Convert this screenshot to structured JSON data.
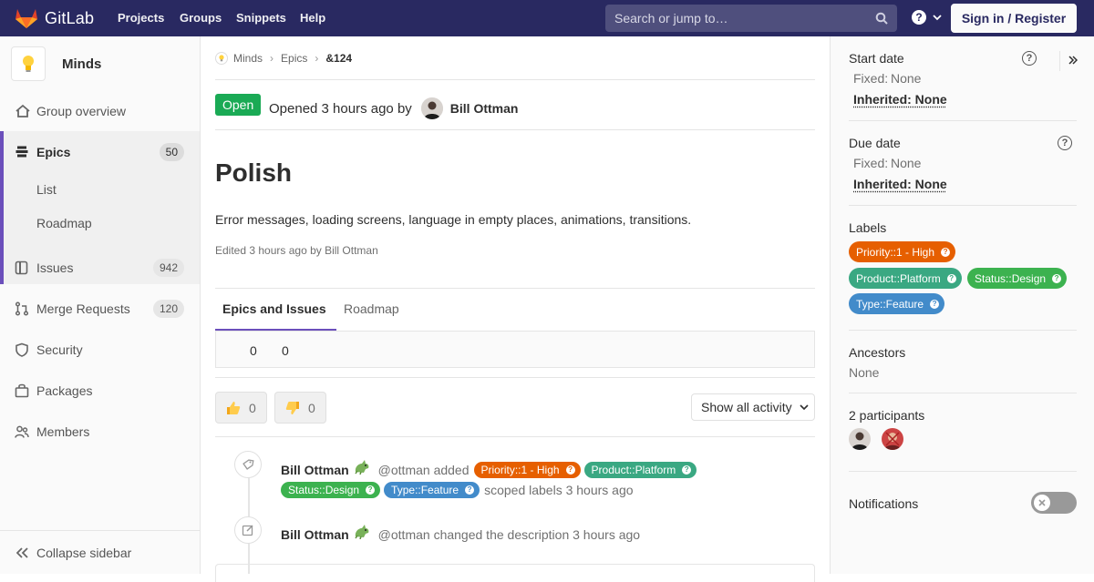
{
  "topnav": {
    "brand": "GitLab",
    "links": [
      "Projects",
      "Groups",
      "Snippets",
      "Help"
    ],
    "search_placeholder": "Search or jump to…",
    "signin_label": "Sign in / Register"
  },
  "sidebar": {
    "group_name": "Minds",
    "items": [
      {
        "label": "Group overview"
      },
      {
        "label": "Epics",
        "count": "50"
      },
      {
        "label": "List"
      },
      {
        "label": "Roadmap"
      },
      {
        "label": "Issues",
        "count": "942"
      },
      {
        "label": "Merge Requests",
        "count": "120"
      },
      {
        "label": "Security"
      },
      {
        "label": "Packages"
      },
      {
        "label": "Members"
      }
    ],
    "collapse_label": "Collapse sidebar"
  },
  "breadcrumb": [
    "Minds",
    "Epics",
    "&124"
  ],
  "epic": {
    "status": "Open",
    "opened_text": "Opened 3 hours ago by",
    "author": "Bill Ottman",
    "title": "Polish",
    "description": "Error messages, loading screens, language in empty places, animations, transitions.",
    "edited": "Edited 3 hours ago by Bill Ottman"
  },
  "tabs": [
    "Epics and Issues",
    "Roadmap"
  ],
  "counts": [
    "0",
    "0"
  ],
  "awards": {
    "thumbsup": "0",
    "thumbsdown": "0"
  },
  "activity_filter": "Show all activity",
  "notes": [
    {
      "author": "Bill Ottman",
      "handle": "@ottman added",
      "labels_line1": [
        {
          "text": "Priority::1 - High",
          "color": "#e65f00"
        },
        {
          "text": "Product::Platform",
          "color": "#3aa882"
        }
      ],
      "labels_line2": [
        {
          "text": "Status::Design",
          "color": "#3cb24f"
        },
        {
          "text": "Type::Feature",
          "color": "#428bca"
        }
      ],
      "suffix": "scoped labels 3 hours ago"
    },
    {
      "author": "Bill Ottman",
      "handle": "@ottman changed the description 3 hours ago"
    }
  ],
  "rightbar": {
    "start_date": {
      "title": "Start date",
      "fixed_label": "Fixed:",
      "fixed_value": "None",
      "inherited": "Inherited: None"
    },
    "due_date": {
      "title": "Due date",
      "fixed_label": "Fixed:",
      "fixed_value": "None",
      "inherited": "Inherited: None"
    },
    "labels_title": "Labels",
    "labels": [
      {
        "text": "Priority::1 - High",
        "color": "#e65f00"
      },
      {
        "text": "Product::Platform",
        "color": "#3aa882"
      },
      {
        "text": "Status::Design",
        "color": "#3cb24f"
      },
      {
        "text": "Type::Feature",
        "color": "#428bca"
      }
    ],
    "ancestors_title": "Ancestors",
    "ancestors_value": "None",
    "participants_title": "2 participants",
    "notifications_title": "Notifications"
  }
}
